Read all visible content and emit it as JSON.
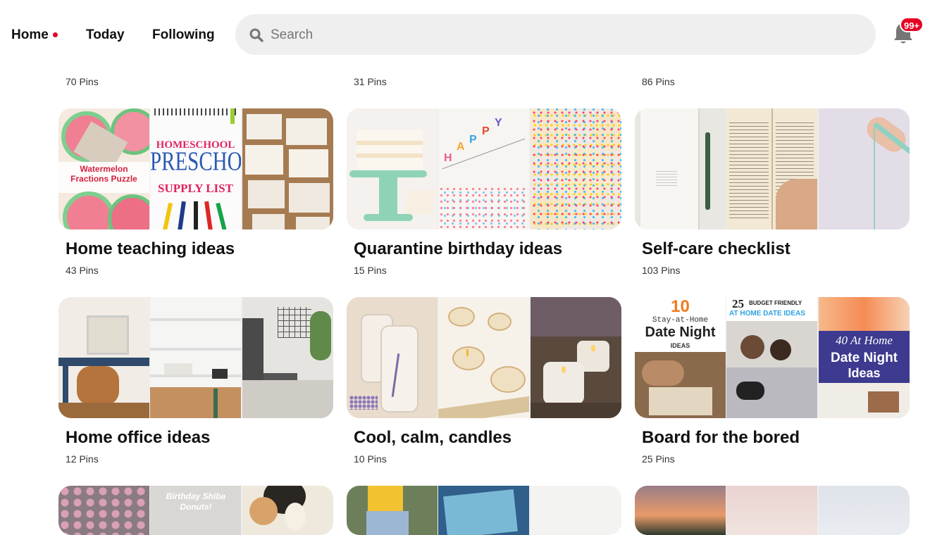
{
  "nav": {
    "home": "Home",
    "today": "Today",
    "following": "Following"
  },
  "search": {
    "placeholder": "Search",
    "value": ""
  },
  "notifications": {
    "badge": "99+"
  },
  "colors": {
    "accent": "#e60023",
    "search_bg": "#efefef"
  },
  "prev_row": {
    "counts": [
      "70 Pins",
      "31 Pins",
      "86 Pins"
    ]
  },
  "boards": [
    {
      "title": "Home teaching ideas",
      "count": "43 Pins",
      "tile_texts": {
        "puzzle_line1": "Watermelon",
        "puzzle_line2": "Fractions Puzzle",
        "homeschool": "HOMESCHOOL",
        "preschool": "PRESCHOOL",
        "supply": "SUPPLY LIST"
      }
    },
    {
      "title": "Quarantine birthday ideas",
      "count": "15 Pins"
    },
    {
      "title": "Self-care checklist",
      "count": "103 Pins"
    },
    {
      "title": "Home office ideas",
      "count": "12 Pins"
    },
    {
      "title": "Cool, calm, candles",
      "count": "10 Pins"
    },
    {
      "title": "Board for the bored",
      "count": "25 Pins",
      "tile_texts": {
        "ten": "10",
        "stay": "Stay-at-Home",
        "date_night": "Date Night",
        "ideas_small": "IDEAS",
        "budget_num": "25",
        "budget": "BUDGET FRIENDLY",
        "athome": "AT HOME DATE IDEAS",
        "forty": "40 At Home",
        "dn2": "Date Night",
        "ideas2": "Ideas"
      }
    }
  ],
  "next_row": {
    "birthday_tile": "Birthday Shiba Donuts!"
  }
}
